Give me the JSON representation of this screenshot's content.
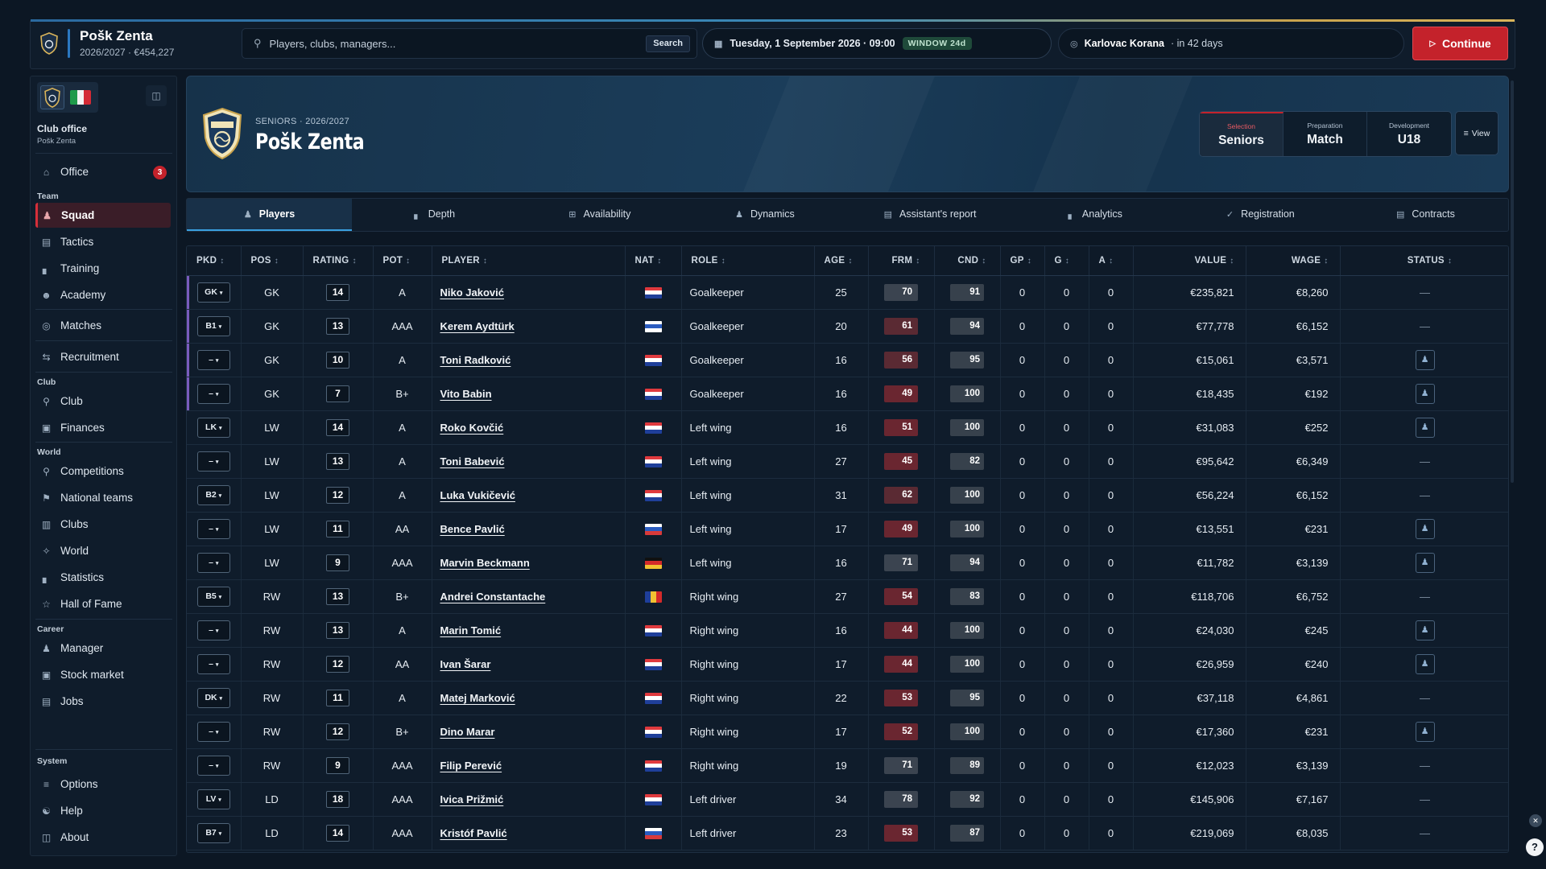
{
  "app": {
    "club_name": "Pošk Zenta",
    "season_money": "2026/2027 · €454,227",
    "search_placeholder": "Players, clubs, managers...",
    "search_button": "Search",
    "date": "Tuesday, 1 September 2026 · 09:00",
    "window": "WINDOW 24d",
    "next_opponent": "Karlovac Korana",
    "next_in": "· in 42 days",
    "continue": "Continue",
    "accent_color": "#c4222b"
  },
  "sidebar": {
    "office_title": "Club office",
    "office_club": "Pošk Zenta",
    "office": {
      "label": "Office",
      "icon": "home-icon",
      "badge": "3"
    },
    "sections": {
      "team": "Team",
      "club": "Club",
      "world": "World",
      "career": "Career",
      "system": "System"
    },
    "team": [
      {
        "label": "Squad",
        "icon": "people-icon"
      },
      {
        "label": "Tactics",
        "icon": "document-icon"
      },
      {
        "label": "Training",
        "icon": "bar-chart-icon"
      },
      {
        "label": "Academy",
        "icon": "person-icon"
      },
      {
        "label": "Matches",
        "icon": "target-icon"
      },
      {
        "label": "Recruitment",
        "icon": "transfer-icon"
      }
    ],
    "club": [
      {
        "label": "Club",
        "icon": "trophy-icon"
      },
      {
        "label": "Finances",
        "icon": "money-icon"
      }
    ],
    "world": [
      {
        "label": "Competitions",
        "icon": "trophy-icon"
      },
      {
        "label": "National teams",
        "icon": "flag-icon"
      },
      {
        "label": "Clubs",
        "icon": "building-icon"
      },
      {
        "label": "World",
        "icon": "globe-icon"
      },
      {
        "label": "Statistics",
        "icon": "bar-chart-icon"
      },
      {
        "label": "Hall of Fame",
        "icon": "star-icon"
      }
    ],
    "career": [
      {
        "label": "Manager",
        "icon": "people-icon"
      },
      {
        "label": "Stock market",
        "icon": "chart-icon"
      },
      {
        "label": "Jobs",
        "icon": "document-icon"
      }
    ],
    "system": [
      {
        "label": "Options",
        "icon": "sliders-icon"
      },
      {
        "label": "Help",
        "icon": "help-icon"
      },
      {
        "label": "About",
        "icon": "book-icon"
      }
    ]
  },
  "hero": {
    "subtitle": "SENIORS · 2026/2027",
    "title": "Pošk Zenta",
    "selectors": [
      {
        "key": "Selection",
        "value": "Seniors",
        "active": true
      },
      {
        "key": "Preparation",
        "value": "Match",
        "active": false
      },
      {
        "key": "Development",
        "value": "U18",
        "active": false
      }
    ],
    "view": "View"
  },
  "tabs": [
    {
      "label": "Players",
      "icon": "people-icon"
    },
    {
      "label": "Depth",
      "icon": "bar-chart-icon"
    },
    {
      "label": "Availability",
      "icon": "grid-icon"
    },
    {
      "label": "Dynamics",
      "icon": "people-icon"
    },
    {
      "label": "Assistant's report",
      "icon": "document-icon"
    },
    {
      "label": "Analytics",
      "icon": "bar-chart-icon"
    },
    {
      "label": "Registration",
      "icon": "check-icon"
    },
    {
      "label": "Contracts",
      "icon": "briefcase-icon"
    }
  ],
  "columns": [
    "PKD",
    "POS",
    "RATING",
    "POT",
    "PLAYER",
    "NAT",
    "ROLE",
    "AGE",
    "FRM",
    "CND",
    "GP",
    "G",
    "A",
    "VALUE",
    "WAGE",
    "STATUS"
  ],
  "players": [
    {
      "pkd": "GK",
      "pos": "GK",
      "rating": "14",
      "pot": "A",
      "name": "Niko Jaković",
      "nat": "hr",
      "role": "Goalkeeper",
      "age": "25",
      "frm": "70",
      "cnd": "91",
      "gp": "0",
      "g": "0",
      "a": "0",
      "value": "€235,821",
      "wage": "€8,260",
      "status": "—"
    },
    {
      "pkd": "B1",
      "pos": "GK",
      "rating": "13",
      "pot": "AAA",
      "name": "Kerem Aydtürk",
      "nat": "il",
      "role": "Goalkeeper",
      "age": "20",
      "frm": "61",
      "cnd": "94",
      "gp": "0",
      "g": "0",
      "a": "0",
      "value": "€77,778",
      "wage": "€6,152",
      "status": "—"
    },
    {
      "pkd": "–",
      "pos": "GK",
      "rating": "10",
      "pot": "A",
      "name": "Toni Radković",
      "nat": "hr",
      "role": "Goalkeeper",
      "age": "16",
      "frm": "56",
      "cnd": "95",
      "gp": "0",
      "g": "0",
      "a": "0",
      "value": "€15,061",
      "wage": "€3,571",
      "status": "icon"
    },
    {
      "pkd": "–",
      "pos": "GK",
      "rating": "7",
      "pot": "B+",
      "name": "Vito Babin",
      "nat": "hr",
      "role": "Goalkeeper",
      "age": "16",
      "frm": "49",
      "cnd": "100",
      "gp": "0",
      "g": "0",
      "a": "0",
      "value": "€18,435",
      "wage": "€192",
      "status": "icon"
    },
    {
      "pkd": "LK",
      "pos": "LW",
      "rating": "14",
      "pot": "A",
      "name": "Roko Kovčić",
      "nat": "hr",
      "role": "Left wing",
      "age": "16",
      "frm": "51",
      "cnd": "100",
      "gp": "0",
      "g": "0",
      "a": "0",
      "value": "€31,083",
      "wage": "€252",
      "status": "icon"
    },
    {
      "pkd": "–",
      "pos": "LW",
      "rating": "13",
      "pot": "A",
      "name": "Toni Babević",
      "nat": "hr",
      "role": "Left wing",
      "age": "27",
      "frm": "45",
      "cnd": "82",
      "gp": "0",
      "g": "0",
      "a": "0",
      "value": "€95,642",
      "wage": "€6,349",
      "status": "—"
    },
    {
      "pkd": "B2",
      "pos": "LW",
      "rating": "12",
      "pot": "A",
      "name": "Luka Vukičević",
      "nat": "hr",
      "role": "Left wing",
      "age": "31",
      "frm": "62",
      "cnd": "100",
      "gp": "0",
      "g": "0",
      "a": "0",
      "value": "€56,224",
      "wage": "€6,152",
      "status": "—"
    },
    {
      "pkd": "–",
      "pos": "LW",
      "rating": "11",
      "pot": "AA",
      "name": "Bence Pavlić",
      "nat": "ru",
      "role": "Left wing",
      "age": "17",
      "frm": "49",
      "cnd": "100",
      "gp": "0",
      "g": "0",
      "a": "0",
      "value": "€13,551",
      "wage": "€231",
      "status": "icon"
    },
    {
      "pkd": "–",
      "pos": "LW",
      "rating": "9",
      "pot": "AAA",
      "name": "Marvin Beckmann",
      "nat": "de",
      "role": "Left wing",
      "age": "16",
      "frm": "71",
      "cnd": "94",
      "gp": "0",
      "g": "0",
      "a": "0",
      "value": "€11,782",
      "wage": "€3,139",
      "status": "icon"
    },
    {
      "pkd": "B5",
      "pos": "RW",
      "rating": "13",
      "pot": "B+",
      "name": "Andrei Constantache",
      "nat": "ro",
      "role": "Right wing",
      "age": "27",
      "frm": "54",
      "cnd": "83",
      "gp": "0",
      "g": "0",
      "a": "0",
      "value": "€118,706",
      "wage": "€6,752",
      "status": "—"
    },
    {
      "pkd": "–",
      "pos": "RW",
      "rating": "13",
      "pot": "A",
      "name": "Marin Tomić",
      "nat": "hr",
      "role": "Right wing",
      "age": "16",
      "frm": "44",
      "cnd": "100",
      "gp": "0",
      "g": "0",
      "a": "0",
      "value": "€24,030",
      "wage": "€245",
      "status": "icon"
    },
    {
      "pkd": "–",
      "pos": "RW",
      "rating": "12",
      "pot": "AA",
      "name": "Ivan Šarar",
      "nat": "hr",
      "role": "Right wing",
      "age": "17",
      "frm": "44",
      "cnd": "100",
      "gp": "0",
      "g": "0",
      "a": "0",
      "value": "€26,959",
      "wage": "€240",
      "status": "icon"
    },
    {
      "pkd": "DK",
      "pos": "RW",
      "rating": "11",
      "pot": "A",
      "name": "Matej Marković",
      "nat": "hr",
      "role": "Right wing",
      "age": "22",
      "frm": "53",
      "cnd": "95",
      "gp": "0",
      "g": "0",
      "a": "0",
      "value": "€37,118",
      "wage": "€4,861",
      "status": "—"
    },
    {
      "pkd": "–",
      "pos": "RW",
      "rating": "12",
      "pot": "B+",
      "name": "Dino Marar",
      "nat": "hr",
      "role": "Right wing",
      "age": "17",
      "frm": "52",
      "cnd": "100",
      "gp": "0",
      "g": "0",
      "a": "0",
      "value": "€17,360",
      "wage": "€231",
      "status": "icon"
    },
    {
      "pkd": "–",
      "pos": "RW",
      "rating": "9",
      "pot": "AAA",
      "name": "Filip Perević",
      "nat": "hr",
      "role": "Right wing",
      "age": "19",
      "frm": "71",
      "cnd": "89",
      "gp": "0",
      "g": "0",
      "a": "0",
      "value": "€12,023",
      "wage": "€3,139",
      "status": "—"
    },
    {
      "pkd": "LV",
      "pos": "LD",
      "rating": "18",
      "pot": "AAA",
      "name": "Ivica Prižmić",
      "nat": "hr",
      "role": "Left driver",
      "age": "34",
      "frm": "78",
      "cnd": "92",
      "gp": "0",
      "g": "0",
      "a": "0",
      "value": "€145,906",
      "wage": "€7,167",
      "status": "—"
    },
    {
      "pkd": "B7",
      "pos": "LD",
      "rating": "14",
      "pot": "AAA",
      "name": "Kristóf Pavlić",
      "nat": "ru",
      "role": "Left driver",
      "age": "23",
      "frm": "53",
      "cnd": "87",
      "gp": "0",
      "g": "0",
      "a": "0",
      "value": "€219,069",
      "wage": "€8,035",
      "status": "—"
    }
  ]
}
